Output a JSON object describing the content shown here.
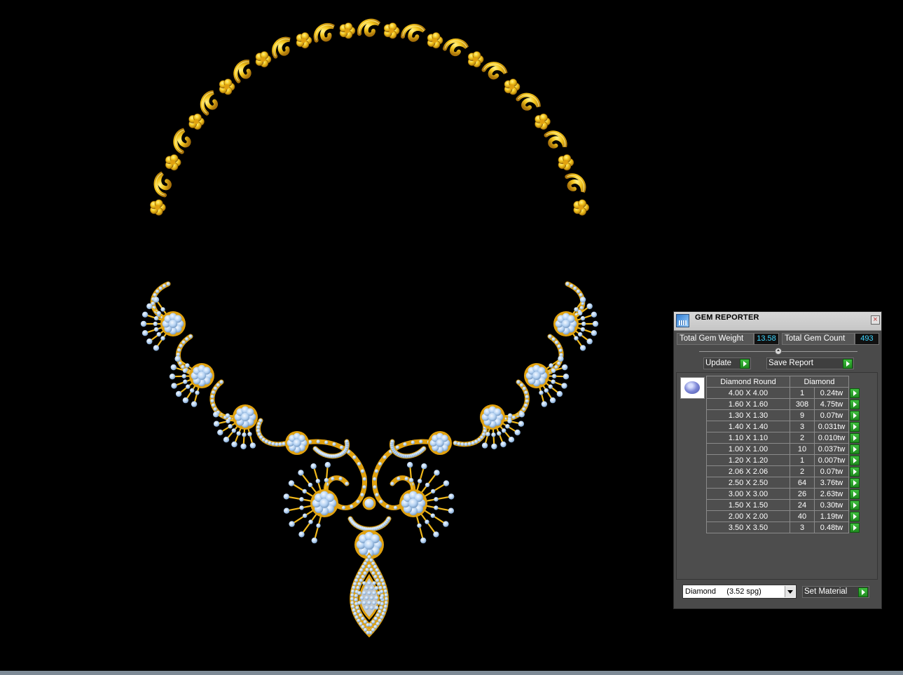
{
  "window": {
    "title": "GEM REPORTER",
    "close_symbol": "×"
  },
  "summary": {
    "total_weight_label": "Total Gem Weight",
    "total_weight_value": "13.58",
    "total_count_label": "Total Gem Count",
    "total_count_value": "493"
  },
  "actions": {
    "update_label": "Update",
    "save_report_label": "Save Report",
    "set_material_label": "Set Material"
  },
  "table": {
    "header_shape": "Diamond Round",
    "header_material": "Diamond",
    "rows": [
      {
        "size": "4.00 X 4.00",
        "count": "1",
        "weight": "0.24tw"
      },
      {
        "size": "1.60 X 1.60",
        "count": "308",
        "weight": "4.75tw"
      },
      {
        "size": "1.30 X 1.30",
        "count": "9",
        "weight": "0.07tw"
      },
      {
        "size": "1.40 X 1.40",
        "count": "3",
        "weight": "0.031tw"
      },
      {
        "size": "1.10 X 1.10",
        "count": "2",
        "weight": "0.010tw"
      },
      {
        "size": "1.00 X 1.00",
        "count": "10",
        "weight": "0.037tw"
      },
      {
        "size": "1.20 X 1.20",
        "count": "1",
        "weight": "0.007tw"
      },
      {
        "size": "2.06 X 2.06",
        "count": "2",
        "weight": "0.07tw"
      },
      {
        "size": "2.50 X 2.50",
        "count": "64",
        "weight": "3.76tw"
      },
      {
        "size": "3.00 X 3.00",
        "count": "26",
        "weight": "2.63tw"
      },
      {
        "size": "1.50 X 1.50",
        "count": "24",
        "weight": "0.30tw"
      },
      {
        "size": "2.00 X 2.00",
        "count": "40",
        "weight": "1.19tw"
      },
      {
        "size": "3.50 X 3.50",
        "count": "3",
        "weight": "0.48tw"
      }
    ]
  },
  "material": {
    "selected": "Diamond     (3.52 spg)"
  },
  "icons": {
    "title": "report-icon",
    "close": "close-icon",
    "go": "green-arrow-icon",
    "gem": "round-gem-icon",
    "dropdown": "chevron-down-icon"
  },
  "colors": {
    "viewport_background": "#000000",
    "gold": "#f2c51c",
    "stone": "#b7d4f4",
    "panel": "#4a4a4a",
    "value_text": "#3fd6ff",
    "action_green": "#2fa82f"
  }
}
